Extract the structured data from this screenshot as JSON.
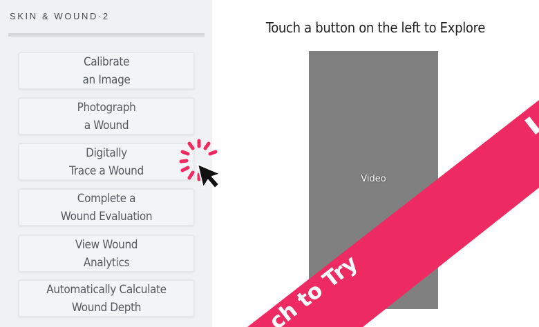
{
  "sidebar": {
    "brand": "SKIN & WOUND·2",
    "buttons": [
      {
        "line1": "Calibrate",
        "line2": "an Image"
      },
      {
        "line1": "Photograph",
        "line2": "a Wound"
      },
      {
        "line1": "Digitally",
        "line2": "Trace a Wound"
      },
      {
        "line1": "Complete a",
        "line2": "Wound Evaluation"
      },
      {
        "line1": "View Wound",
        "line2": "Analytics"
      },
      {
        "line1": "Automatically Calculate",
        "line2": "Wound Depth"
      }
    ]
  },
  "main": {
    "title": "Touch a button on the left to Explore",
    "video_label": "Video"
  },
  "ribbon": {
    "text": "ch to Try",
    "color": "#ee2a62",
    "text_color": "#ffffff"
  },
  "icons": {
    "click_cursor": "cursor-click-icon",
    "click_burst_color": "#ee2a62"
  }
}
